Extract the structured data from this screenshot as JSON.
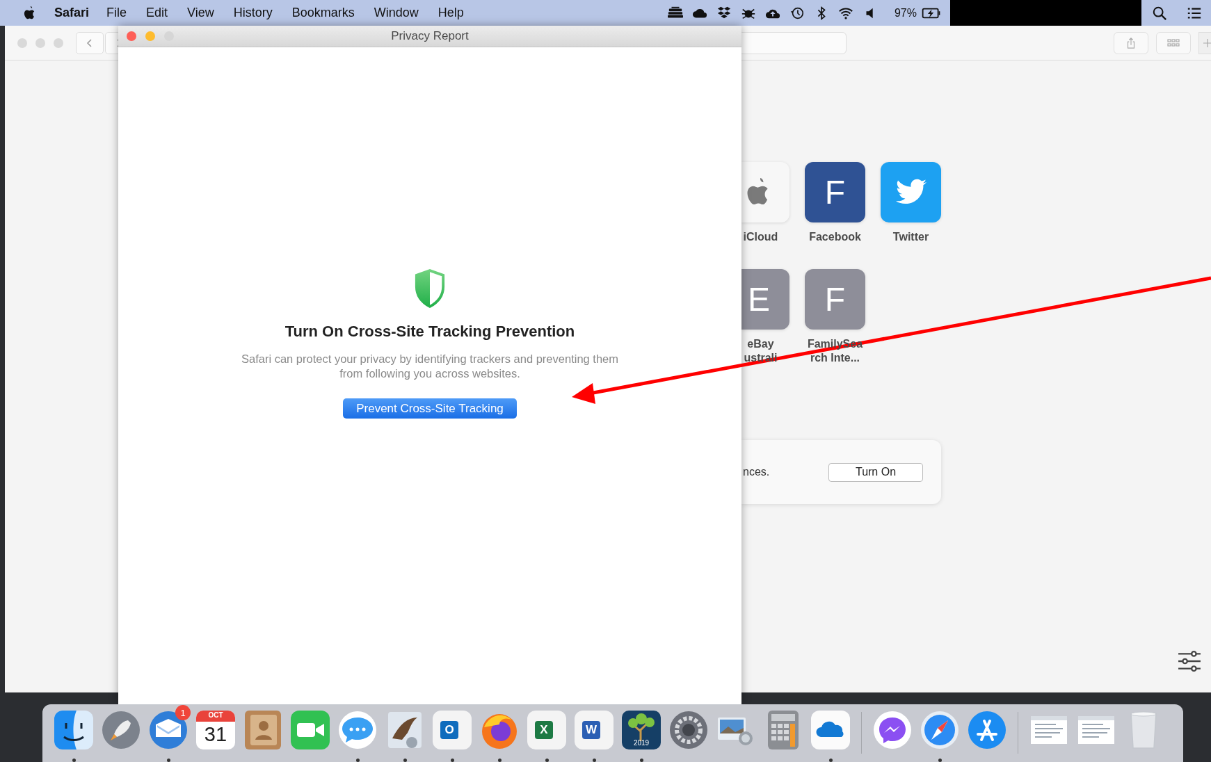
{
  "menu_bar": {
    "app": "Safari",
    "menus": [
      "File",
      "Edit",
      "View",
      "History",
      "Bookmarks",
      "Window",
      "Help"
    ],
    "status_items": [
      {
        "kind": "drive"
      },
      {
        "kind": "cloud"
      },
      {
        "kind": "dropbox"
      },
      {
        "kind": "bug"
      },
      {
        "kind": "upload"
      },
      {
        "kind": "history"
      },
      {
        "kind": "bluetooth"
      },
      {
        "kind": "wifi"
      },
      {
        "kind": "volume"
      },
      {
        "kind": "text",
        "text": "97%"
      },
      {
        "kind": "battery"
      },
      {
        "kind": "redacted"
      },
      {
        "kind": "search"
      },
      {
        "kind": "list"
      }
    ]
  },
  "safari_window": {
    "favorites": [
      {
        "kind": "apple",
        "label_lines": [
          "iCloud"
        ],
        "color": "#f7f7f7",
        "partial": true
      },
      {
        "kind": "letter",
        "letter": "F",
        "label_lines": [
          "Facebook"
        ],
        "color": "#2f5294",
        "partial": false
      },
      {
        "kind": "bird",
        "label_lines": [
          "Twitter"
        ],
        "color": "#1da1f2",
        "partial": false
      },
      {
        "kind": "letter",
        "letter": "E",
        "label_lines": [
          "eBay",
          "ustrali"
        ],
        "color": "#8e8e99",
        "partial": true
      },
      {
        "kind": "letter",
        "letter": "F",
        "label_lines": [
          "FamilySea",
          "rch Inte..."
        ],
        "color": "#8e8e99",
        "partial": false
      }
    ],
    "privacy_card": {
      "text": "nces.",
      "button": "Turn On"
    }
  },
  "privacy_report": {
    "title": "Privacy Report",
    "heading": "Turn On Cross-Site Tracking Prevention",
    "body": "Safari can protect your privacy by identifying trackers and preventing them from following you across websites.",
    "button": "Prevent Cross-Site Tracking"
  },
  "dock": {
    "items": [
      {
        "kind": "finder",
        "running": true
      },
      {
        "kind": "rocket",
        "running": false
      },
      {
        "kind": "mail",
        "running": true,
        "badge": "1"
      },
      {
        "kind": "calendar",
        "running": false,
        "month": "OCT",
        "day": "31"
      },
      {
        "kind": "contacts",
        "running": false
      },
      {
        "kind": "video",
        "running": false
      },
      {
        "kind": "chat",
        "running": true
      },
      {
        "kind": "eagle",
        "running": true
      },
      {
        "kind": "letter",
        "running": true,
        "letter": "O",
        "color": "#0f6cbd"
      },
      {
        "kind": "firefox",
        "running": true
      },
      {
        "kind": "letter",
        "running": true,
        "letter": "X",
        "color": "#1d7a44"
      },
      {
        "kind": "letter",
        "running": true,
        "letter": "W",
        "color": "#2b5fb4"
      },
      {
        "kind": "tree",
        "running": true,
        "caption": "2019"
      },
      {
        "kind": "gear",
        "running": false
      },
      {
        "kind": "preview",
        "running": false
      },
      {
        "kind": "calculator",
        "running": false
      },
      {
        "kind": "onedrive",
        "running": true
      },
      {
        "kind": "separator"
      },
      {
        "kind": "messenger",
        "running": false
      },
      {
        "kind": "compass",
        "running": true
      },
      {
        "kind": "appstore",
        "running": false
      },
      {
        "kind": "separator"
      },
      {
        "kind": "thumb",
        "running": false
      },
      {
        "kind": "thumb",
        "running": false
      },
      {
        "kind": "trash",
        "running": false
      }
    ]
  }
}
